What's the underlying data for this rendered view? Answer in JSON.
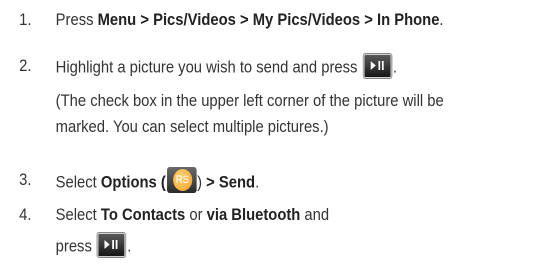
{
  "steps": [
    {
      "number": "1.",
      "parts": [
        "Press ",
        "Menu",
        " > ",
        "Pics/Videos",
        " > ",
        "My Pics/Videos",
        " > ",
        "In Phone",
        "."
      ]
    },
    {
      "number": "2.",
      "text": "Highlight a picture you wish to send and press",
      "end": ".",
      "note_line1": "(The check box in the upper left corner of the picture will be",
      "note_line2": "marked. You can select multiple pictures.)"
    },
    {
      "number": "3.",
      "pre": "Select ",
      "options": "Options",
      "paren_open": " (",
      "softkey_label": "RS",
      "paren_close": ") ",
      "gt": "> ",
      "send": "Send",
      "end": "."
    },
    {
      "number": "4.",
      "pre": "Select ",
      "to_contacts": "To Contacts",
      "mid": " or ",
      "via_bt": "via Bluetooth",
      "post": " and",
      "line2": "press",
      "end": "."
    }
  ],
  "icons": {
    "play_pause_key": "play-pause-icon",
    "right_softkey": "right-softkey-icon"
  }
}
